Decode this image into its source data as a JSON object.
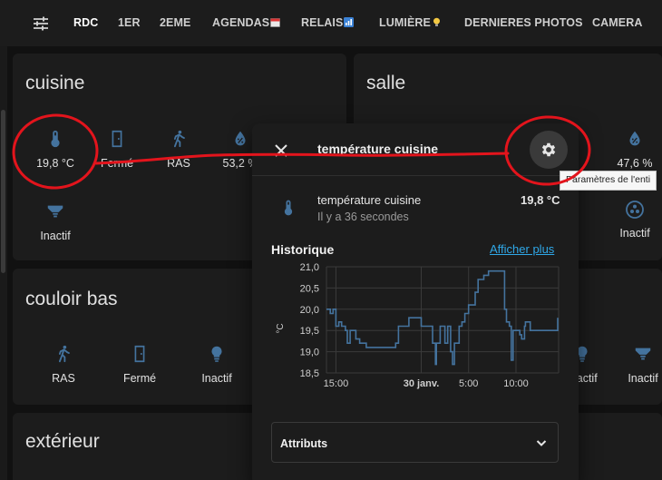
{
  "nav": {
    "tabs": [
      {
        "label": "RDC",
        "emoji": ""
      },
      {
        "label": "1ER",
        "emoji": ""
      },
      {
        "label": "2EME",
        "emoji": ""
      },
      {
        "label": "AGENDAS",
        "emoji": "calendar-icon"
      },
      {
        "label": "RELAIS",
        "emoji": "chart-icon"
      },
      {
        "label": "LUMIÈRE",
        "emoji": "bulb-icon"
      },
      {
        "label": "DERNIERES PHOTOS",
        "emoji": ""
      },
      {
        "label": "CAMERA",
        "emoji": ""
      }
    ]
  },
  "cards": {
    "cuisine": {
      "title": "cuisine",
      "entities": [
        {
          "icon": "thermometer-icon",
          "label": "19,8 °C"
        },
        {
          "icon": "door-icon",
          "label": "Fermé"
        },
        {
          "icon": "walk-icon",
          "label": "RAS"
        },
        {
          "icon": "water-icon",
          "label": "53,2 %"
        },
        {
          "icon": "spotlight-icon",
          "label": "Inactif"
        }
      ]
    },
    "salle": {
      "title": "salle",
      "entities": [
        {
          "icon": "water-icon",
          "label": "47,6 %"
        },
        {
          "icon": "fan-icon",
          "label": "Inactif"
        }
      ]
    },
    "couloir_bas": {
      "title": "couloir bas",
      "entities": [
        {
          "icon": "walk-icon",
          "label": "RAS"
        },
        {
          "icon": "door-icon",
          "label": "Fermé"
        },
        {
          "icon": "bulb-icon",
          "label": "Inactif"
        },
        {
          "icon": "bulb-icon",
          "label": "Inactif"
        },
        {
          "icon": "spotlight-icon",
          "label": "Inactif"
        }
      ]
    },
    "exterieur": {
      "title": "extérieur"
    }
  },
  "dialog": {
    "title": "température cuisine",
    "entity_name": "température cuisine",
    "last_changed": "Il y a 36 secondes",
    "value": "19,8 °C",
    "history_title": "Historique",
    "show_more": "Afficher plus",
    "attributes_label": "Attributs"
  },
  "tooltip": {
    "text": "Paramètres de l'enti"
  },
  "colors": {
    "accent": "#44739e",
    "link": "#2fa8e8",
    "annotation": "#e3141c"
  },
  "chart_data": {
    "type": "line",
    "ylabel": "°C",
    "ylim": [
      18.5,
      21.0
    ],
    "yticks": [
      "18,5",
      "19,0",
      "19,5",
      "20,0",
      "20,5",
      "21,0"
    ],
    "xticks": [
      {
        "label": "15:00",
        "t": 0
      },
      {
        "label": "30 janv.",
        "t": 9
      },
      {
        "label": "5:00",
        "t": 14
      },
      {
        "label": "10:00",
        "t": 19
      }
    ],
    "x_range": [
      -1,
      23.5
    ],
    "series": [
      {
        "name": "",
        "color": "#44739e",
        "step": true,
        "points": [
          [
            -1,
            20.0
          ],
          [
            -0.6,
            19.9
          ],
          [
            -0.3,
            20.0
          ],
          [
            0,
            19.6
          ],
          [
            0.3,
            19.7
          ],
          [
            0.6,
            19.6
          ],
          [
            1.0,
            19.5
          ],
          [
            1.2,
            19.2
          ],
          [
            1.5,
            19.5
          ],
          [
            2.1,
            19.3
          ],
          [
            2.5,
            19.2
          ],
          [
            3.2,
            19.1
          ],
          [
            5.0,
            19.1
          ],
          [
            6.3,
            19.2
          ],
          [
            6.6,
            19.6
          ],
          [
            7.5,
            19.6
          ],
          [
            7.7,
            19.8
          ],
          [
            8.8,
            19.8
          ],
          [
            9.0,
            19.6
          ],
          [
            9.7,
            19.6
          ],
          [
            10.2,
            19.2
          ],
          [
            10.5,
            18.7
          ],
          [
            10.6,
            19.2
          ],
          [
            11.0,
            19.6
          ],
          [
            11.5,
            19.2
          ],
          [
            11.8,
            19.6
          ],
          [
            12.1,
            19.0
          ],
          [
            12.3,
            18.7
          ],
          [
            12.5,
            19.2
          ],
          [
            13.0,
            19.6
          ],
          [
            13.3,
            19.7
          ],
          [
            13.6,
            19.9
          ],
          [
            13.9,
            19.9
          ],
          [
            14.0,
            20.1
          ],
          [
            14.7,
            20.4
          ],
          [
            15.0,
            20.7
          ],
          [
            15.6,
            20.8
          ],
          [
            16.1,
            20.9
          ],
          [
            17.6,
            20.9
          ],
          [
            17.8,
            20.0
          ],
          [
            18.0,
            19.7
          ],
          [
            18.3,
            19.6
          ],
          [
            18.5,
            18.8
          ],
          [
            18.7,
            19.5
          ],
          [
            19.0,
            19.5
          ],
          [
            19.4,
            19.4
          ],
          [
            19.6,
            19.3
          ],
          [
            19.9,
            19.6
          ],
          [
            20.0,
            19.7
          ],
          [
            20.5,
            19.5
          ],
          [
            21.5,
            19.5
          ],
          [
            22.0,
            19.5
          ],
          [
            23.0,
            19.5
          ],
          [
            23.4,
            19.8
          ]
        ]
      }
    ]
  }
}
